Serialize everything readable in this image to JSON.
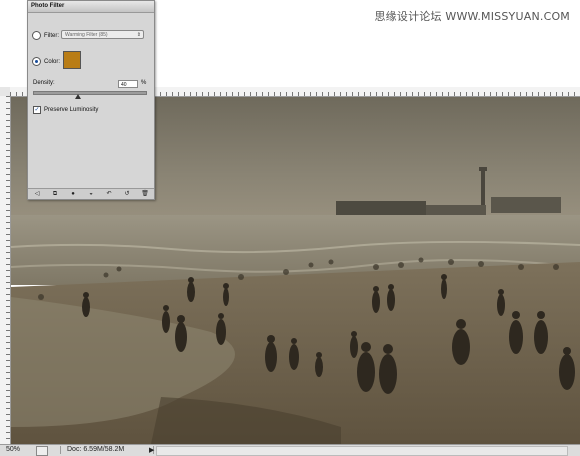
{
  "watermark": "思缘设计论坛  WWW.MISSYUAN.COM",
  "panel": {
    "title": "Photo Filter",
    "filter_label": "Filter:",
    "filter_value": "Warming Filter (85)",
    "color_label": "Color:",
    "color_swatch": "#b97d16",
    "density_label": "Density:",
    "density_value": "40",
    "density_unit": "%",
    "density_level": 0.4,
    "preserve_label": "Preserve Luminosity",
    "preserve_checked": true,
    "selected_option": "color",
    "toolbar_icons": [
      "eye-toggle-icon",
      "clip-to-layer-icon",
      "visibility-icon",
      "view-previous-icon",
      "reset-icon",
      "delete-icon"
    ]
  },
  "status": {
    "zoom": "50%",
    "doc": "Doc: 6.59M/58.2M",
    "arrow": "▶"
  }
}
